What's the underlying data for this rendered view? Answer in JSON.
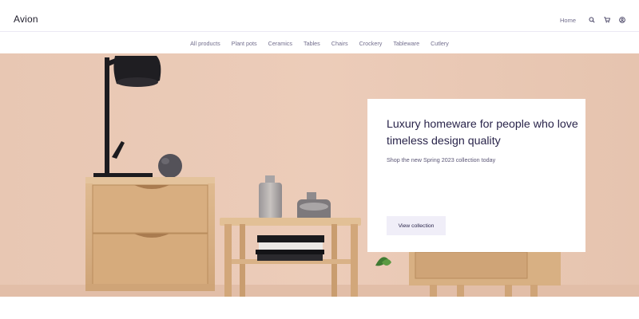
{
  "brand": {
    "name": "Avion"
  },
  "header": {
    "home_label": "Home",
    "icons": [
      "search-icon",
      "cart-icon",
      "user-icon"
    ]
  },
  "categories": [
    {
      "label": "All products"
    },
    {
      "label": "Plant pots"
    },
    {
      "label": "Ceramics"
    },
    {
      "label": "Tables"
    },
    {
      "label": "Chairs"
    },
    {
      "label": "Crockery"
    },
    {
      "label": "Tableware"
    },
    {
      "label": "Cutlery"
    }
  ],
  "hero": {
    "title": "Luxury homeware for people who love timeless design quality",
    "subtitle": "Shop the new Spring 2023 collection today",
    "cta_label": "View collection"
  },
  "colors": {
    "wall": "#e9c9b5",
    "wood": "#d9b287",
    "text_dark": "#2a254b",
    "text_muted": "#726e8d",
    "button_bg": "#f0eef8"
  }
}
